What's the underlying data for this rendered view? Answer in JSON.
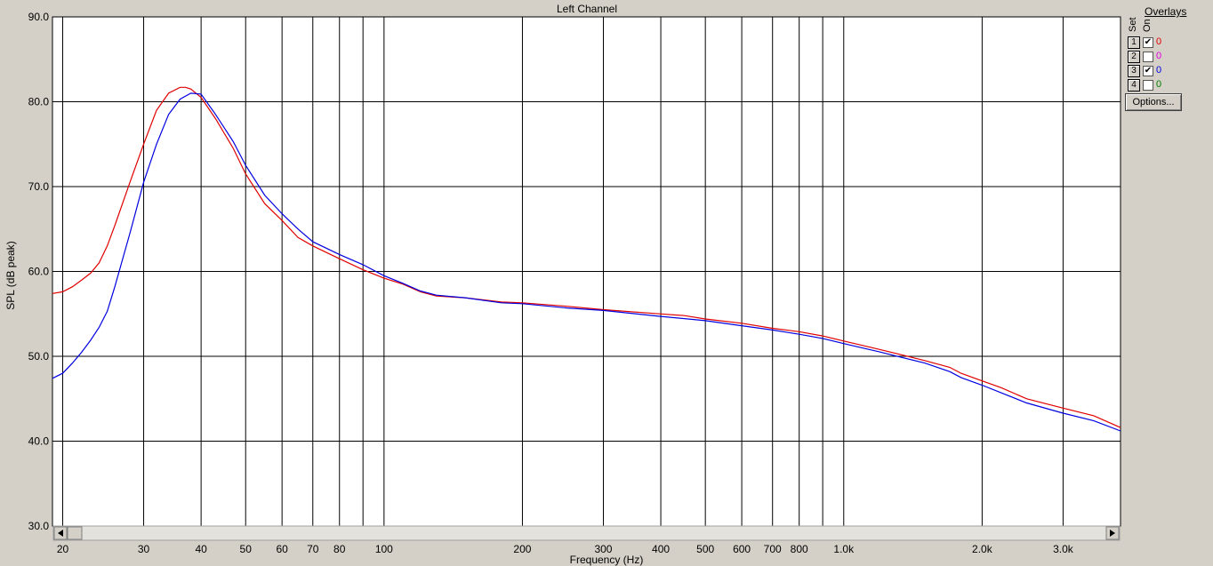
{
  "overlays": {
    "title": "Overlays",
    "set_label": "Set",
    "on_label": "On",
    "rows": [
      {
        "set": "1",
        "on": true,
        "value": "0",
        "color": "#e00000"
      },
      {
        "set": "2",
        "on": false,
        "value": "0",
        "color": "#e000e0"
      },
      {
        "set": "3",
        "on": true,
        "value": "0",
        "color": "#0000e0"
      },
      {
        "set": "4",
        "on": false,
        "value": "0",
        "color": "#008000"
      }
    ],
    "options_label": "Options..."
  },
  "chart_data": {
    "type": "line",
    "title": "Left Channel",
    "xlabel": "Frequency (Hz)",
    "ylabel": "SPL (dB peak)",
    "xscale": "log",
    "xlim": [
      19,
      4000
    ],
    "ylim": [
      30,
      90
    ],
    "grid": true,
    "y_ticks": [
      "90.0",
      "80.0",
      "70.0",
      "60.0",
      "50.0",
      "40.0",
      "30.0"
    ],
    "y_tick_values": [
      90,
      80,
      70,
      60,
      50,
      40,
      30
    ],
    "x_ticks": [
      {
        "value": 20,
        "label": "20"
      },
      {
        "value": 30,
        "label": "30"
      },
      {
        "value": 40,
        "label": "40"
      },
      {
        "value": 50,
        "label": "50"
      },
      {
        "value": 60,
        "label": "60"
      },
      {
        "value": 70,
        "label": "70"
      },
      {
        "value": 80,
        "label": "80"
      },
      {
        "value": 90,
        "label": ""
      },
      {
        "value": 100,
        "label": "100"
      },
      {
        "value": 200,
        "label": "200"
      },
      {
        "value": 300,
        "label": "300"
      },
      {
        "value": 400,
        "label": "400"
      },
      {
        "value": 500,
        "label": "500"
      },
      {
        "value": 600,
        "label": "600"
      },
      {
        "value": 700,
        "label": "700"
      },
      {
        "value": 800,
        "label": "800"
      },
      {
        "value": 900,
        "label": ""
      },
      {
        "value": 1000,
        "label": "1.0k"
      },
      {
        "value": 2000,
        "label": "2.0k"
      },
      {
        "value": 3000,
        "label": "3.0k"
      }
    ],
    "series": [
      {
        "color": "#e00000",
        "points": [
          [
            19,
            57.4
          ],
          [
            20,
            57.6
          ],
          [
            21,
            58.2
          ],
          [
            22,
            59
          ],
          [
            23,
            59.8
          ],
          [
            24,
            61
          ],
          [
            25,
            63
          ],
          [
            26,
            65.5
          ],
          [
            28,
            70.5
          ],
          [
            30,
            75
          ],
          [
            32,
            79
          ],
          [
            34,
            81
          ],
          [
            36,
            81.7
          ],
          [
            37,
            81.7
          ],
          [
            38,
            81.5
          ],
          [
            40,
            80.5
          ],
          [
            43,
            78
          ],
          [
            47,
            74.5
          ],
          [
            50,
            71.5
          ],
          [
            55,
            68
          ],
          [
            60,
            66
          ],
          [
            65,
            64
          ],
          [
            70,
            63
          ],
          [
            80,
            61.5
          ],
          [
            90,
            60.2
          ],
          [
            100,
            59.2
          ],
          [
            110,
            58.5
          ],
          [
            120,
            57.6
          ],
          [
            130,
            57.1
          ],
          [
            150,
            56.9
          ],
          [
            180,
            56.4
          ],
          [
            200,
            56.3
          ],
          [
            250,
            55.9
          ],
          [
            300,
            55.5
          ],
          [
            400,
            55
          ],
          [
            450,
            54.8
          ],
          [
            500,
            54.4
          ],
          [
            600,
            53.9
          ],
          [
            700,
            53.3
          ],
          [
            800,
            52.9
          ],
          [
            900,
            52.4
          ],
          [
            1000,
            51.8
          ],
          [
            1200,
            50.8
          ],
          [
            1500,
            49.5
          ],
          [
            1700,
            48.7
          ],
          [
            1800,
            48
          ],
          [
            2000,
            47.1
          ],
          [
            2200,
            46.3
          ],
          [
            2500,
            45
          ],
          [
            3000,
            43.9
          ],
          [
            3500,
            43
          ],
          [
            4000,
            41.6
          ]
        ]
      },
      {
        "color": "#0000e0",
        "points": [
          [
            19,
            47.4
          ],
          [
            20,
            48
          ],
          [
            21,
            49.2
          ],
          [
            22,
            50.5
          ],
          [
            23,
            51.9
          ],
          [
            24,
            53.4
          ],
          [
            25,
            55.3
          ],
          [
            26,
            58.3
          ],
          [
            28,
            64.5
          ],
          [
            30,
            70.5
          ],
          [
            32,
            75
          ],
          [
            34,
            78.5
          ],
          [
            36,
            80.3
          ],
          [
            38,
            81
          ],
          [
            40,
            80.9
          ],
          [
            43,
            78.5
          ],
          [
            47,
            75.3
          ],
          [
            50,
            72.5
          ],
          [
            55,
            69
          ],
          [
            60,
            66.8
          ],
          [
            65,
            65
          ],
          [
            70,
            63.5
          ],
          [
            80,
            62
          ],
          [
            90,
            60.8
          ],
          [
            100,
            59.5
          ],
          [
            110,
            58.6
          ],
          [
            120,
            57.7
          ],
          [
            130,
            57.2
          ],
          [
            150,
            56.9
          ],
          [
            180,
            56.3
          ],
          [
            200,
            56.2
          ],
          [
            250,
            55.7
          ],
          [
            300,
            55.4
          ],
          [
            400,
            54.7
          ],
          [
            500,
            54.2
          ],
          [
            600,
            53.6
          ],
          [
            700,
            53.1
          ],
          [
            800,
            52.6
          ],
          [
            900,
            52.1
          ],
          [
            1000,
            51.5
          ],
          [
            1200,
            50.5
          ],
          [
            1500,
            49.2
          ],
          [
            1700,
            48.2
          ],
          [
            1800,
            47.5
          ],
          [
            2000,
            46.6
          ],
          [
            2200,
            45.7
          ],
          [
            2500,
            44.5
          ],
          [
            3000,
            43.3
          ],
          [
            3500,
            42.4
          ],
          [
            4000,
            41.2
          ]
        ]
      }
    ]
  }
}
